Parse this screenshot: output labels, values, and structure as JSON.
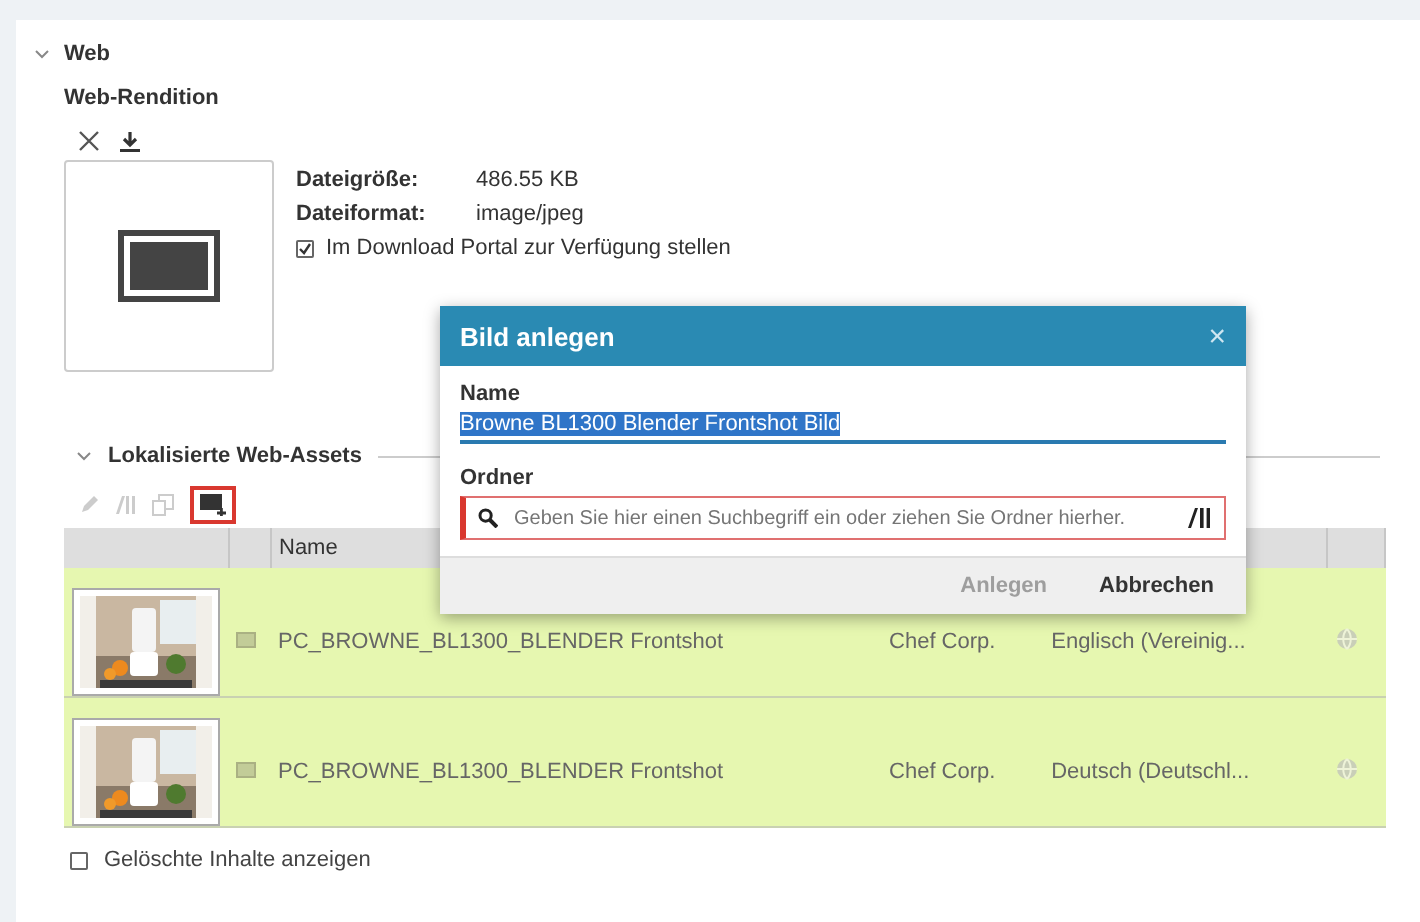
{
  "section": {
    "title": "Web",
    "expanded": true
  },
  "rendition": {
    "title": "Web-Rendition",
    "details": [
      {
        "label": "Dateigröße:",
        "value": "486.55 KB"
      },
      {
        "label": "Dateiformat:",
        "value": "image/jpeg"
      }
    ],
    "portal": {
      "label": "Im Download Portal zur Verfügung stellen",
      "checked": true
    }
  },
  "assets": {
    "title": "Lokalisierte Web-Assets",
    "expanded": true,
    "table": {
      "columns": [
        "Name"
      ],
      "rows": [
        {
          "name": "PC_BROWNE_BL1300_BLENDER Frontshot",
          "owner": "Chef Corp.",
          "language": "Englisch (Vereinig..."
        },
        {
          "name": "PC_BROWNE_BL1300_BLENDER Frontshot",
          "owner": "Chef Corp.",
          "language": "Deutsch (Deutschl..."
        }
      ]
    },
    "show_deleted": {
      "label": "Gelöschte Inhalte anzeigen",
      "checked": false
    }
  },
  "dialog": {
    "title": "Bild anlegen",
    "close": "×",
    "name_label": "Name",
    "name_value": "Browne BL1300 Blender Frontshot Bild",
    "folder_label": "Ordner",
    "folder_placeholder": "Geben Sie hier einen Suchbegriff ein oder ziehen Sie Ordner hierher.",
    "buttons": [
      {
        "label": "Anlegen",
        "disabled": true
      },
      {
        "label": "Abbrechen",
        "disabled": false
      }
    ]
  }
}
